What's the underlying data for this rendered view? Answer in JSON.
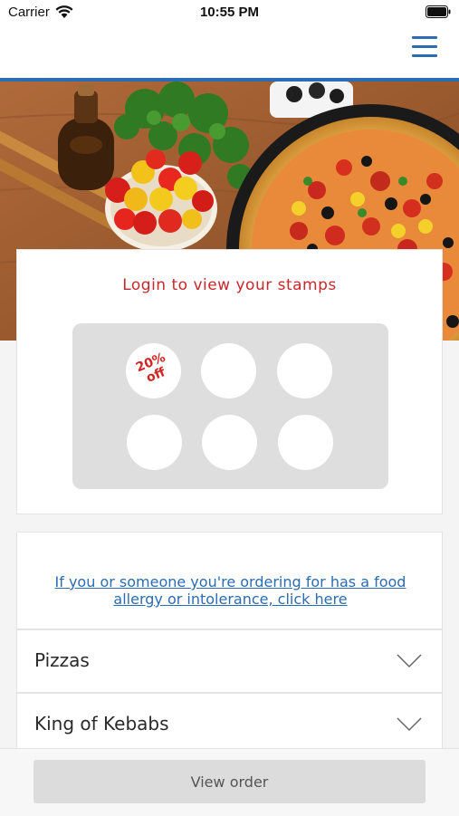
{
  "status_bar": {
    "carrier": "Carrier",
    "time": "10:55 PM"
  },
  "header": {
    "menu_icon": "hamburger-menu-icon",
    "accent_color": "#2b6cb3"
  },
  "hero": {
    "image": "pizza-and-tomatoes-photo"
  },
  "stamp_card": {
    "title": "Login to view your stamps",
    "title_color": "#c8282a",
    "stamps_total": 6,
    "reward": {
      "line1": "20%",
      "line2": "off"
    }
  },
  "allergy": {
    "link_line1": "If you or someone you're ordering for has a food",
    "link_line2": "allergy or intolerance, click here"
  },
  "categories": [
    {
      "label": "Pizzas",
      "icon": "chevron-down-icon"
    },
    {
      "label": "King of Kebabs",
      "icon": "chevron-down-icon"
    }
  ],
  "footer": {
    "view_order_label": "View order"
  }
}
